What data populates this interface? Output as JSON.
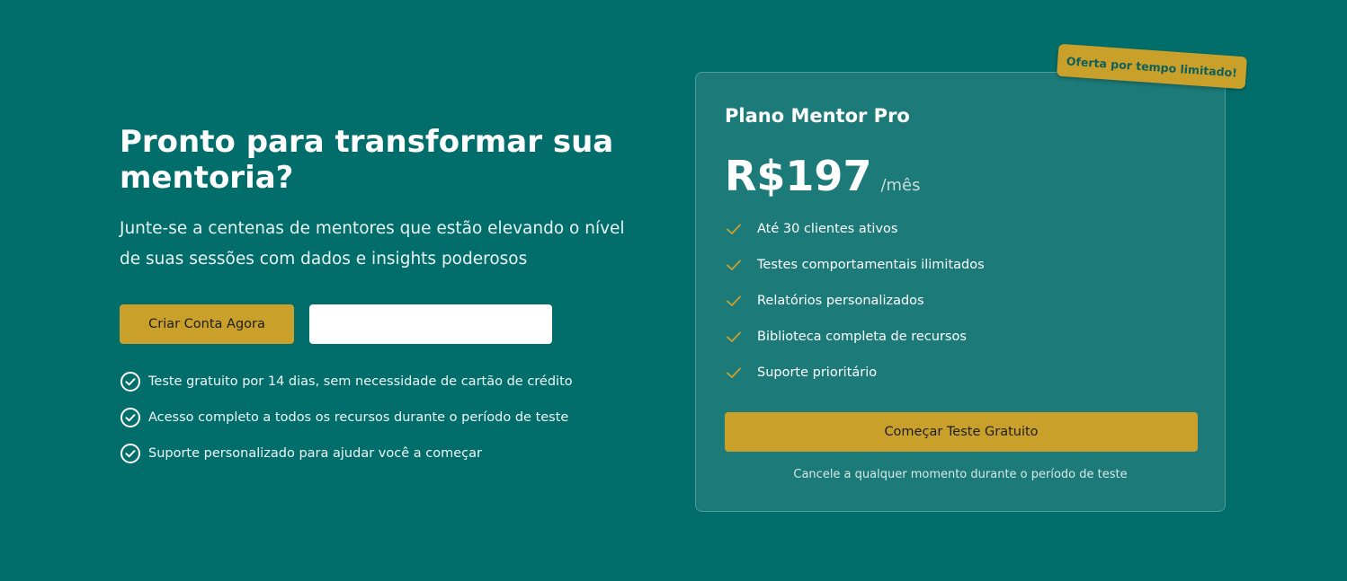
{
  "hero": {
    "headline": "Pronto para transformar sua mentoria?",
    "subtext": "Junte-se a centenas de mentores que estão elevando o nível de suas sessões com dados e insights poderosos",
    "primary_button": "Criar Conta Agora",
    "secondary_button": "",
    "benefits": [
      "Teste gratuito por 14 dias, sem necessidade de cartão de crédito",
      "Acesso completo a todos os recursos durante o período de teste",
      "Suporte personalizado para ajudar você a começar"
    ]
  },
  "plan": {
    "badge": "Oferta por tempo limitado!",
    "name": "Plano Mentor Pro",
    "price": "R$197",
    "period": "/mês",
    "features": [
      "Até 30 clientes ativos",
      "Testes comportamentais ilimitados",
      "Relatórios personalizados",
      "Biblioteca completa de recursos",
      "Suporte prioritário"
    ],
    "cta": "Começar Teste Gratuito",
    "note": "Cancele a qualquer momento durante o período de teste"
  },
  "colors": {
    "background": "#016e6b",
    "card": "#1c7b78",
    "accent": "#c9a02a",
    "text": "#ffffff"
  },
  "icons": {
    "benefit": "check-circle-icon",
    "feature": "check-icon"
  }
}
